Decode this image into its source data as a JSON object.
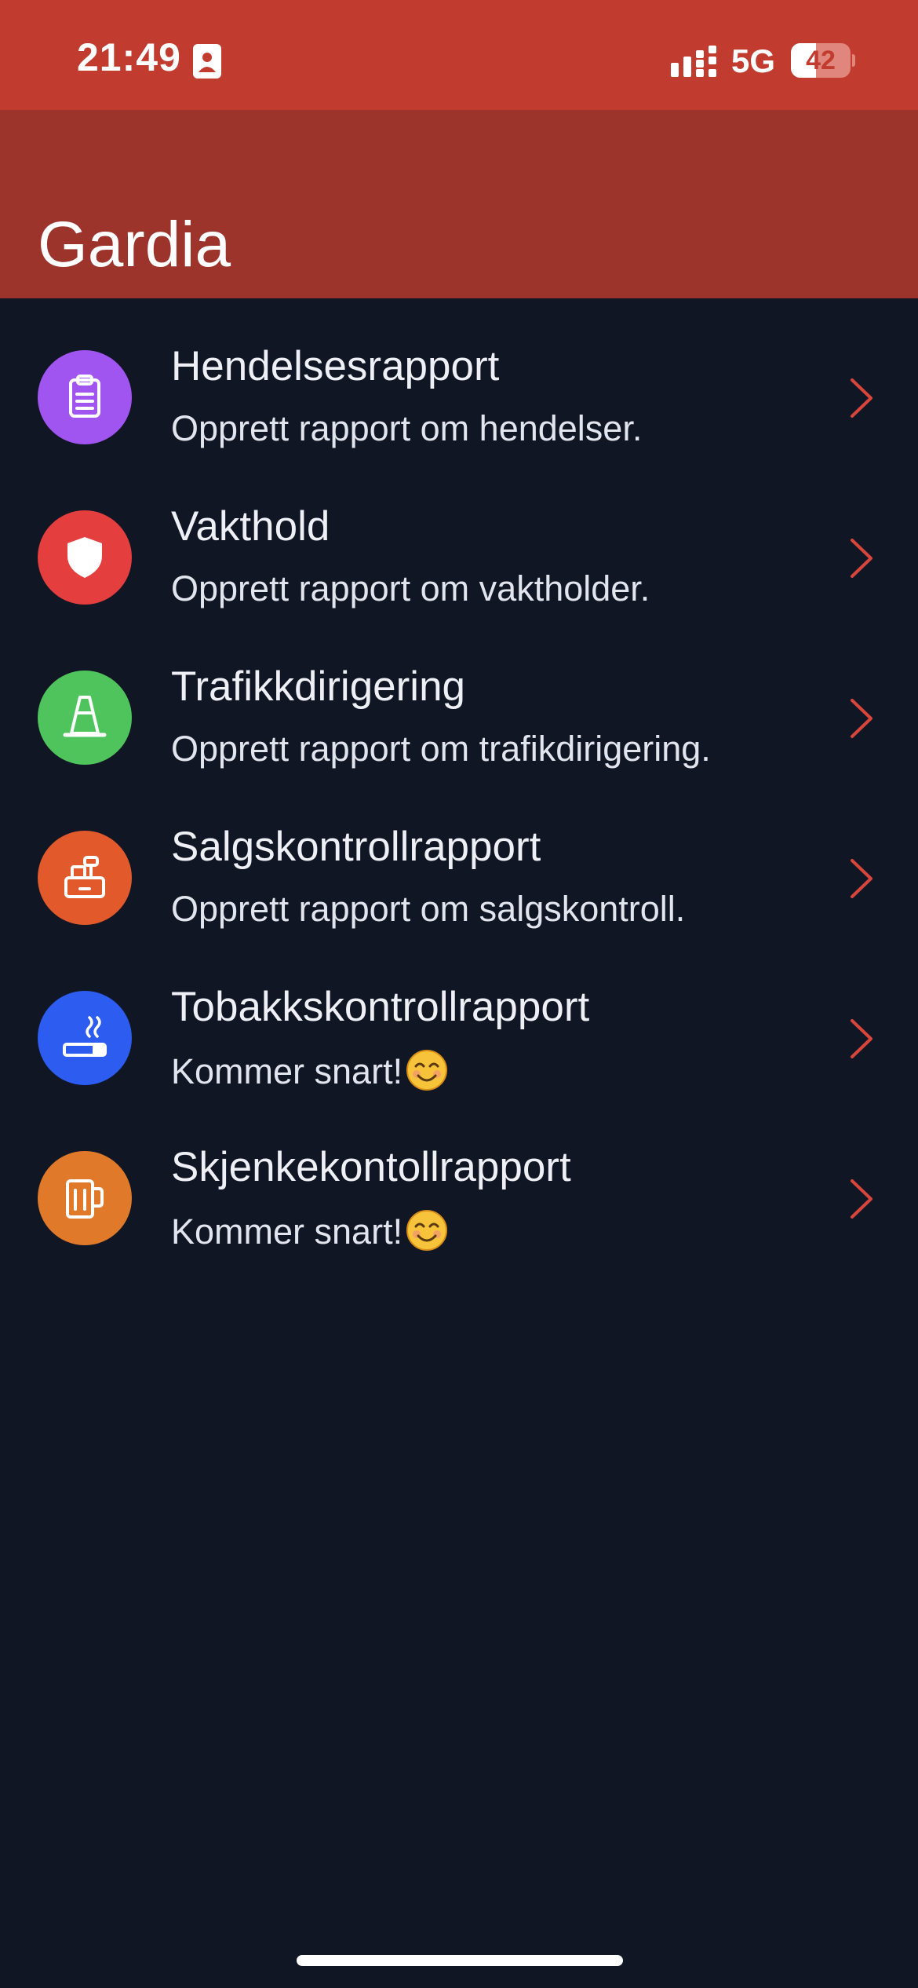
{
  "status_bar": {
    "time": "21:49",
    "network": "5G",
    "battery": "42",
    "battery_level": 0.42
  },
  "header": {
    "title": "Gardia"
  },
  "items": [
    {
      "title": "Hendelsesrapport",
      "subtitle": "Opprett rapport om hendelser.",
      "icon": "clipboard-icon",
      "color": "#a055f0"
    },
    {
      "title": "Vakthold",
      "subtitle": "Opprett rapport om vaktholder.",
      "icon": "shield-icon",
      "color": "#e53e3e"
    },
    {
      "title": "Trafikkdirigering",
      "subtitle": "Opprett rapport om trafikdirigering.",
      "icon": "traffic-cone-icon",
      "color": "#4fc45d"
    },
    {
      "title": "Salgskontrollrapport",
      "subtitle": "Opprett rapport om salgskontroll.",
      "icon": "cash-register-icon",
      "color": "#e25a2c"
    },
    {
      "title": "Tobakkskontrollrapport",
      "subtitle": "Kommer snart!",
      "icon": "cigarette-icon",
      "color": "#2c5cf0",
      "emoji": "smiling-face-icon"
    },
    {
      "title": "Skjenkekontollrapport",
      "subtitle": "Kommer snart!",
      "icon": "beer-mug-icon",
      "color": "#e07a2a",
      "emoji": "smiling-face-icon"
    }
  ],
  "colors": {
    "status_bar": "#c23b2f",
    "header": "#9d342c",
    "background": "#111625",
    "chevron": "#d8453a"
  }
}
